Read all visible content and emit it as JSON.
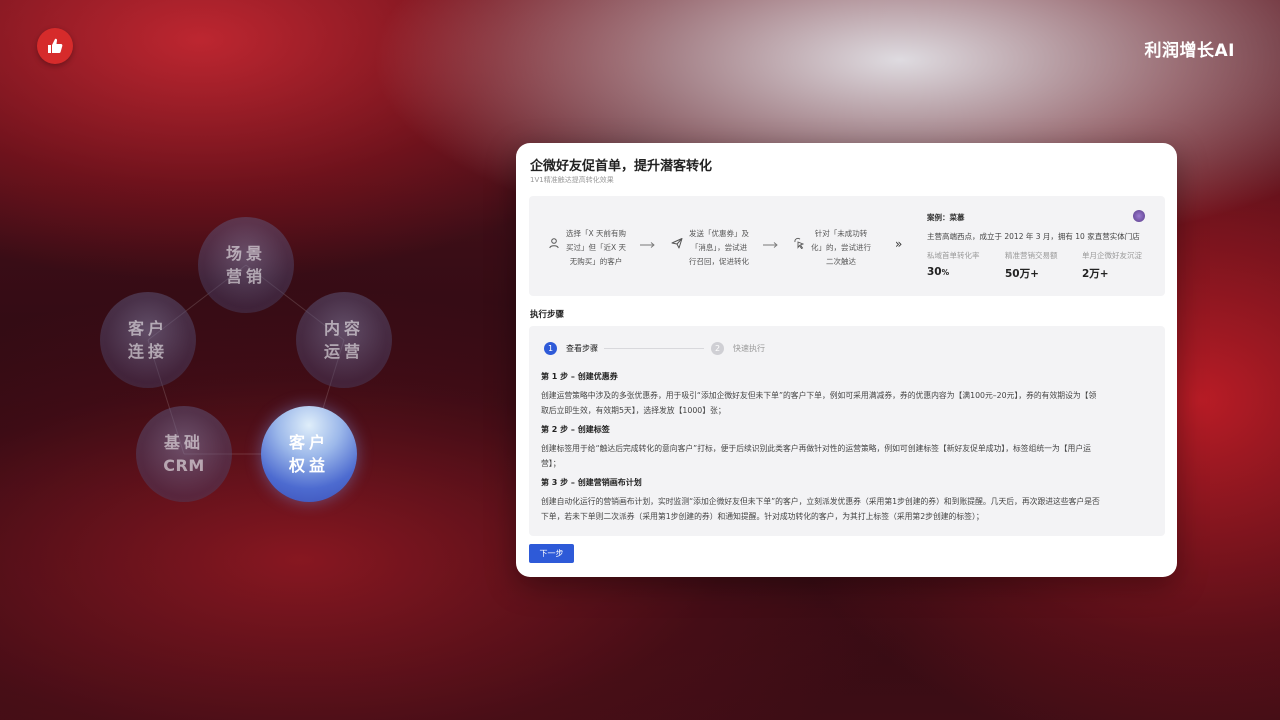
{
  "brand": {
    "name": "利润增长AI"
  },
  "logo": {
    "icon": "thumbs-up-icon",
    "color": "#d62b2b"
  },
  "pentagon": {
    "nodes": [
      {
        "key": "scene",
        "line1": "场景",
        "line2": "营销",
        "active": false
      },
      {
        "key": "content",
        "line1": "内容",
        "line2": "运营",
        "active": false
      },
      {
        "key": "customer-conn",
        "line1": "客户",
        "line2": "连接",
        "active": false
      },
      {
        "key": "crm",
        "line1": "基础",
        "line2": "CRM",
        "active": false
      },
      {
        "key": "benefits",
        "line1": "客户",
        "line2": "权益",
        "active": true
      }
    ]
  },
  "card": {
    "title": "企微好友促首单，提升潜客转化",
    "subtitle": "1V1精准触达提高转化效果",
    "flow": [
      {
        "icon": "user-icon",
        "lines": [
          "选择「X 天前有购",
          "买过」但「近X 天",
          "无购买」的客户"
        ]
      },
      {
        "icon": "send-icon",
        "lines": [
          "发送「优惠券」及",
          "「消息」，尝试进",
          "行召回，促进转化"
        ]
      },
      {
        "icon": "click-icon",
        "lines": [
          "针对「未成功转",
          "化」的，尝试进行",
          "二次触达"
        ]
      }
    ],
    "case": {
      "title": "案例：菜慕",
      "desc": "主营高端西点，成立于 2012 年 3 月，拥有 10 家直营实体门店",
      "stats": [
        {
          "label": "私域首单转化率",
          "value": "30",
          "unit": "%"
        },
        {
          "label": "精准营销交易额",
          "value": "50万+",
          "unit": ""
        },
        {
          "label": "单月企微好友沉淀",
          "value": "2万+",
          "unit": ""
        }
      ]
    },
    "section_title": "执行步骤",
    "stepper": [
      {
        "num": "1",
        "label": "查看步骤",
        "active": true
      },
      {
        "num": "2",
        "label": "快速执行",
        "active": false
      }
    ],
    "steps": [
      {
        "title": "第 1 步 – 创建优惠券",
        "line1": "创建运营策略中涉及的多张优惠券，用于吸引“添加企微好友但未下单”的客户下单，例如可采用满减券，券的优惠内容为【满100元–20元】，券的有效期设为【领",
        "line2": "取后立即生效，有效期5天】，选择发放【1000】张；"
      },
      {
        "title": "第 2 步 – 创建标签",
        "line1": "创建标签用于给“触达后完成转化的意向客户”打标，便于后续识别此类客户再做针对性的运营策略，例如可创建标签【新好友促单成功】，标签组统一为【用户运",
        "line2": "营】；"
      },
      {
        "title": "第 3 步 – 创建营销画布计划",
        "line1": "创建自动化运行的营销画布计划，实时监测“添加企微好友但未下单”的客户，立刻派发优惠券（采用第1步创建的券）和到账提醒。几天后，再次跟进这些客户是否",
        "line2": "下单，若未下单则二次派券（采用第1步创建的券）和通知提醒。针对成功转化的客户，为其打上标签（采用第2步创建的标签）；"
      }
    ],
    "next_button": "下一步"
  },
  "colors": {
    "accent": "#2e5ad8",
    "brand_red": "#d62b2b"
  }
}
